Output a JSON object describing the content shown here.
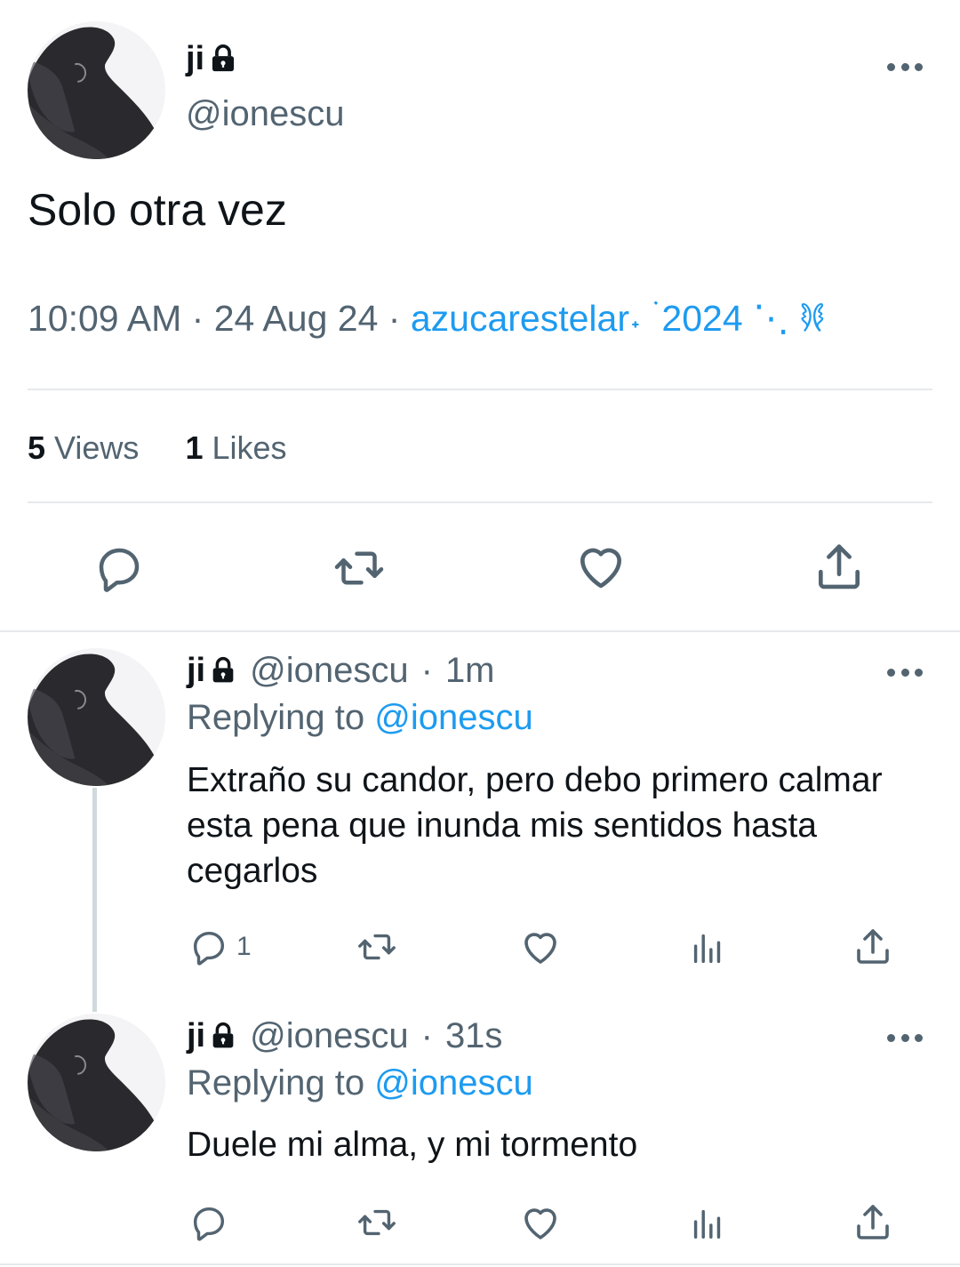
{
  "main_tweet": {
    "display_name": "ji",
    "handle": "@ionescu",
    "text": "Solo otra vez",
    "time": "10:09 AM",
    "date": "24 Aug 24",
    "separator": "·",
    "source": "azucarestelar˖ ࣪ 𐦍 ⋰ 2024",
    "stats": {
      "views_count": "5",
      "views_label": "Views",
      "likes_count": "1",
      "likes_label": "Likes"
    },
    "actions": [
      "reply-icon",
      "retweet-icon",
      "like-icon",
      "share-icon"
    ]
  },
  "replies": [
    {
      "display_name": "ji",
      "handle": "@ionescu",
      "dot": "·",
      "time": "1m",
      "replying_label": "Replying to",
      "replying_to": "@ionescu",
      "text": "Extraño su candor, pero debo primero calmar esta pena que inunda mis sentidos hasta cegarlos",
      "reply_count": "1"
    },
    {
      "display_name": "ji",
      "handle": "@ionescu",
      "dot": "·",
      "time": "31s",
      "replying_label": "Replying to",
      "replying_to": "@ionescu",
      "text": "Duele mi alma, y mi tormento",
      "reply_count": ""
    }
  ],
  "colors": {
    "accent": "#1d9bf0",
    "secondary_text": "#536471",
    "divider": "#e6e9ec"
  }
}
